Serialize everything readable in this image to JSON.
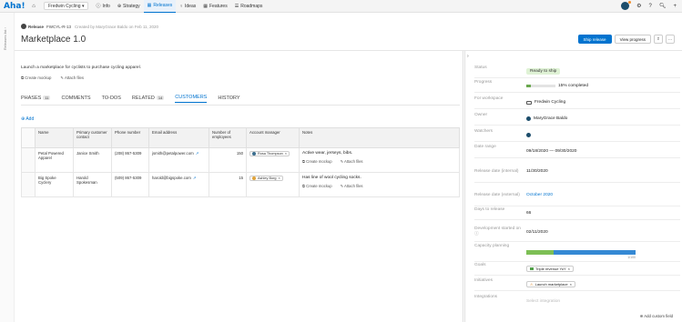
{
  "topbar": {
    "logo": "Aha!",
    "workspace": "Fredwin Cycling",
    "nav": [
      {
        "label": "Info",
        "icon": "info-icon",
        "glyph": "ⓘ"
      },
      {
        "label": "Strategy",
        "icon": "strategy-icon",
        "glyph": "⊕"
      },
      {
        "label": "Releases",
        "icon": "calendar-icon",
        "glyph": "▦"
      },
      {
        "label": "Ideas",
        "icon": "lightbulb-icon",
        "glyph": "♀"
      },
      {
        "label": "Features",
        "icon": "grid-icon",
        "glyph": "▦"
      },
      {
        "label": "Roadmaps",
        "icon": "roadmap-icon",
        "glyph": "☰"
      }
    ]
  },
  "rail": {
    "label": "Releases list"
  },
  "header": {
    "type": "Release",
    "ref": "FWCYL-R-13",
    "meta": "Created by MaryGrace Baldo on Feb 11, 2020",
    "title": "Marketplace 1.0",
    "ship_label": "Ship release",
    "progress_label": "View progress"
  },
  "main": {
    "description": "Launch a marketplace for cyclists to purchase cycling apparel.",
    "create_mockup": "Create mockup",
    "attach_files": "Attach files",
    "tabs": [
      {
        "label": "PHASES",
        "count": "11"
      },
      {
        "label": "COMMENTS",
        "count": ""
      },
      {
        "label": "TO-DOS",
        "count": ""
      },
      {
        "label": "RELATED",
        "count": "14"
      },
      {
        "label": "CUSTOMERS",
        "count": ""
      },
      {
        "label": "HISTORY",
        "count": ""
      }
    ],
    "add_label": "Add",
    "table": {
      "headers": [
        "Name",
        "Primary customer contact",
        "Phone number",
        "Email address",
        "Number of employees",
        "Account manager",
        "Notes"
      ],
      "rows": [
        {
          "name": "Petal Powered Apparel",
          "contact": "Janice Smith",
          "phone": "(208) 867-5309",
          "email": "jsmith@petalpower.com",
          "employees": "150",
          "manager": "Rosa Thompson",
          "notes": "Active wear, jerseys, bibs."
        },
        {
          "name": "Big Spoke Cyclery",
          "contact": "Harold Spokesman",
          "phone": "(509) 867-5309",
          "email": "harold@bigspoke.com",
          "employees": "15",
          "manager": "Ashley Borg",
          "notes": "Has line of wool cycling socks."
        }
      ]
    }
  },
  "side": {
    "status": {
      "label": "Status",
      "value": "Ready to ship"
    },
    "progress": {
      "label": "Progress",
      "value": "15% completed",
      "fraction": 0.15
    },
    "workspace": {
      "label": "For workspace",
      "value": "Fredwin Cycling"
    },
    "owner": {
      "label": "Owner",
      "value": "MaryGrace Baldo"
    },
    "watchers": {
      "label": "Watchers"
    },
    "date_range": {
      "label": "Date range",
      "value": "09/18/2020 — 09/30/2020"
    },
    "release_internal": {
      "label": "Release date (internal)",
      "value": "11/30/2020"
    },
    "release_external": {
      "label": "Release date (external)",
      "value": "October 2020"
    },
    "days": {
      "label": "Days to release",
      "value": "66"
    },
    "dev_started": {
      "label": "Development started on",
      "value": "02/11/2020"
    },
    "capacity": {
      "label": "Capacity planning",
      "value": "1/100",
      "green_fraction": 0.25,
      "blue_fraction": 0.75
    },
    "goals": {
      "label": "Goals",
      "value": "Triple revenue YoY"
    },
    "initiatives": {
      "label": "Initiatives",
      "value": "Launch marketplace"
    },
    "integrations": {
      "label": "Integrations",
      "value": "Select integration"
    },
    "add_custom": "Add custom field"
  },
  "colors": {
    "accent": "#0073cf",
    "status_green": "#dff2d5"
  }
}
